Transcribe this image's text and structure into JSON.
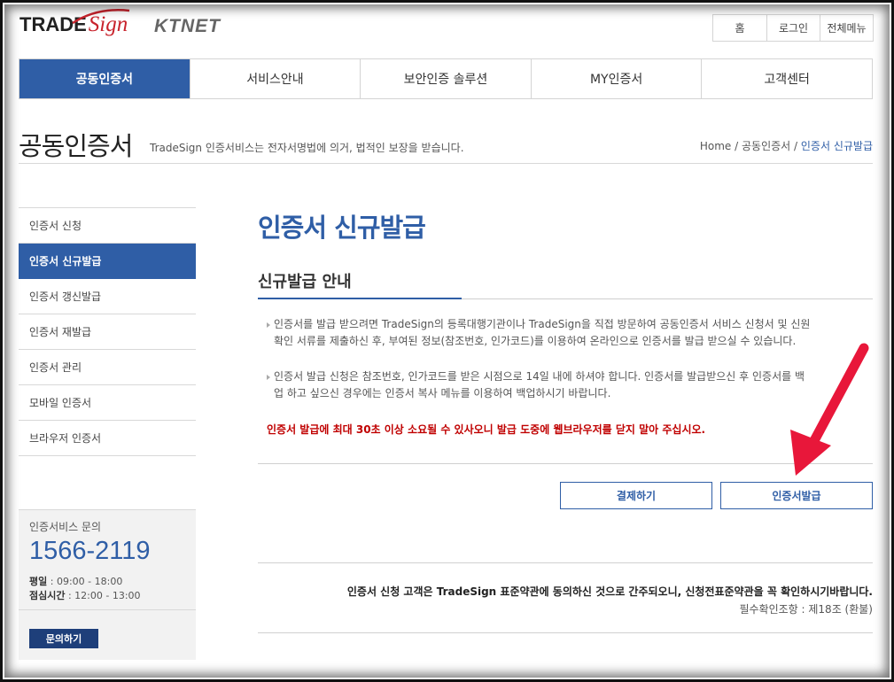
{
  "header": {
    "logo_trade": "TRADE",
    "logo_sign": "Sign",
    "logo_ktnet": "KTNET",
    "util_nav": [
      "홈",
      "로그인",
      "전체메뉴"
    ]
  },
  "gnb": [
    "공동인증서",
    "서비스안내",
    "보안인증 솔루션",
    "MY인증서",
    "고객센터"
  ],
  "title_bar": {
    "title": "공동인증서",
    "desc": "TradeSign 인증서비스는 전자서명법에 의거, 법적인 보장을 받습니다.",
    "breadcrumb": [
      "Home",
      "공동인증서",
      "인증서 신규발급"
    ]
  },
  "lnb": [
    "인증서 신청",
    "인증서 신규발급",
    "인증서 갱신발급",
    "인증서 재발급",
    "인증서 관리",
    "모바일 인증서",
    "브라우저 인증서"
  ],
  "contact": {
    "title": "인증서비스 문의",
    "phone": "1566-2119",
    "weekday_label": "평일",
    "weekday_time": " : 09:00 - 18:00",
    "lunch_label": "점심시간",
    "lunch_time": " : 12:00 - 13:00",
    "button": "문의하기"
  },
  "content": {
    "title": "인증서 신규발급",
    "subtitle": "신규발급 안내",
    "para1_line1": "인증서를 발급 받으려면 TradeSign의 등록대행기관이나 TradeSign을 직접 방문하여 공동인증서 서비스 신청서 및 신원",
    "para1_line2": "확인 서류를 제출하신 후, 부여된 정보(참조번호, 인가코드)를 이용하여 온라인으로 인증서를 발급 받으실 수 있습니다.",
    "para2_line1": "인증서 발급 신청은 참조번호, 인가코드를 받은 시점으로 14일 내에 하셔야 합니다. 인증서를 발급받으신 후 인증서를 백",
    "para2_line2": "업 하고 싶으신 경우에는 인증서 복사 메뉴를 이용하여 백업하시기 바랍니다.",
    "warning": "인증서 발급에 최대 30초 이상 소요될 수 있사오니 발급 도중에 웹브라우저를 닫지 말아 주십시오.",
    "btn_pay": "결제하기",
    "btn_issue": "인증서발급",
    "terms": "인증서 신청 고객은 TradeSign 표준약관에 동의하신 것으로 간주되오니, 신청전표준약관을 꼭 확인하시기바랍니다.",
    "terms_sub": "필수확인조항 : 제18조 (환불)"
  },
  "colors": {
    "brand_blue": "#2f5ea6",
    "warning_red": "#c00000",
    "annotation_arrow": "#e8173a"
  }
}
